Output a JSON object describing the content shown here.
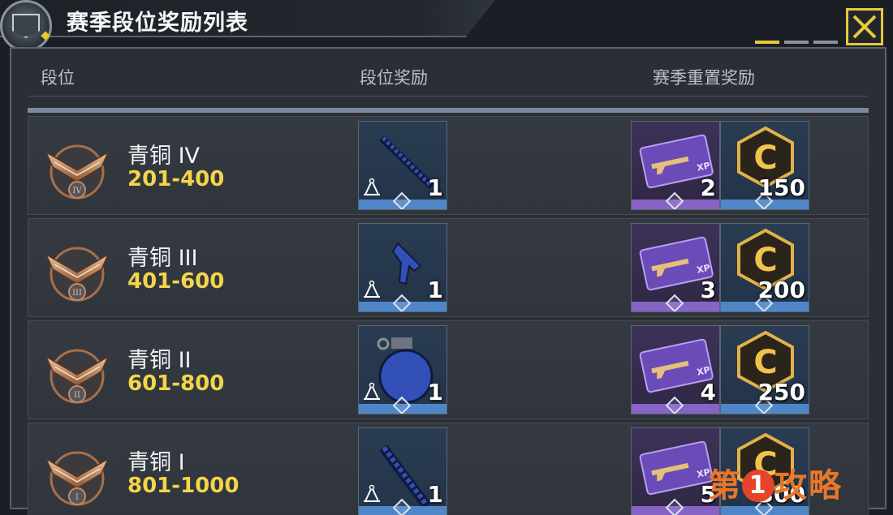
{
  "title": "赛季段位奖励列表",
  "columns": {
    "rank": "段位",
    "rank_reward": "段位奖励",
    "reset_reward": "赛季重置奖励"
  },
  "rows": [
    {
      "rank": "青铜 IV",
      "range": "201-400",
      "emblem_numeral": "IV",
      "weapon": "rifle",
      "weapon_qty": "1",
      "xp_qty": "2",
      "credit_qty": "150"
    },
    {
      "rank": "青铜 III",
      "range": "401-600",
      "emblem_numeral": "III",
      "weapon": "pistol",
      "weapon_qty": "1",
      "xp_qty": "3",
      "credit_qty": "200"
    },
    {
      "rank": "青铜 II",
      "range": "601-800",
      "emblem_numeral": "II",
      "weapon": "grenade",
      "weapon_qty": "1",
      "xp_qty": "4",
      "credit_qty": "250"
    },
    {
      "rank": "青铜 I",
      "range": "801-1000",
      "emblem_numeral": "I",
      "weapon": "launcher",
      "weapon_qty": "1",
      "xp_qty": "5",
      "credit_qty": "300"
    }
  ],
  "icons": {
    "close": "close-icon",
    "xp_card": "xp-card-icon",
    "credits": "credits-c-icon",
    "blueprint": "blueprint-compass-icon"
  },
  "colors": {
    "accent": "#e6c93a",
    "range_text": "#f3d54a",
    "rare_strip": "#4f86c8",
    "epic_strip": "#8663c4"
  },
  "pagination": {
    "pages": 3,
    "active": 1
  },
  "watermark": {
    "pre": "第",
    "num": "1",
    "post": "攻略"
  }
}
